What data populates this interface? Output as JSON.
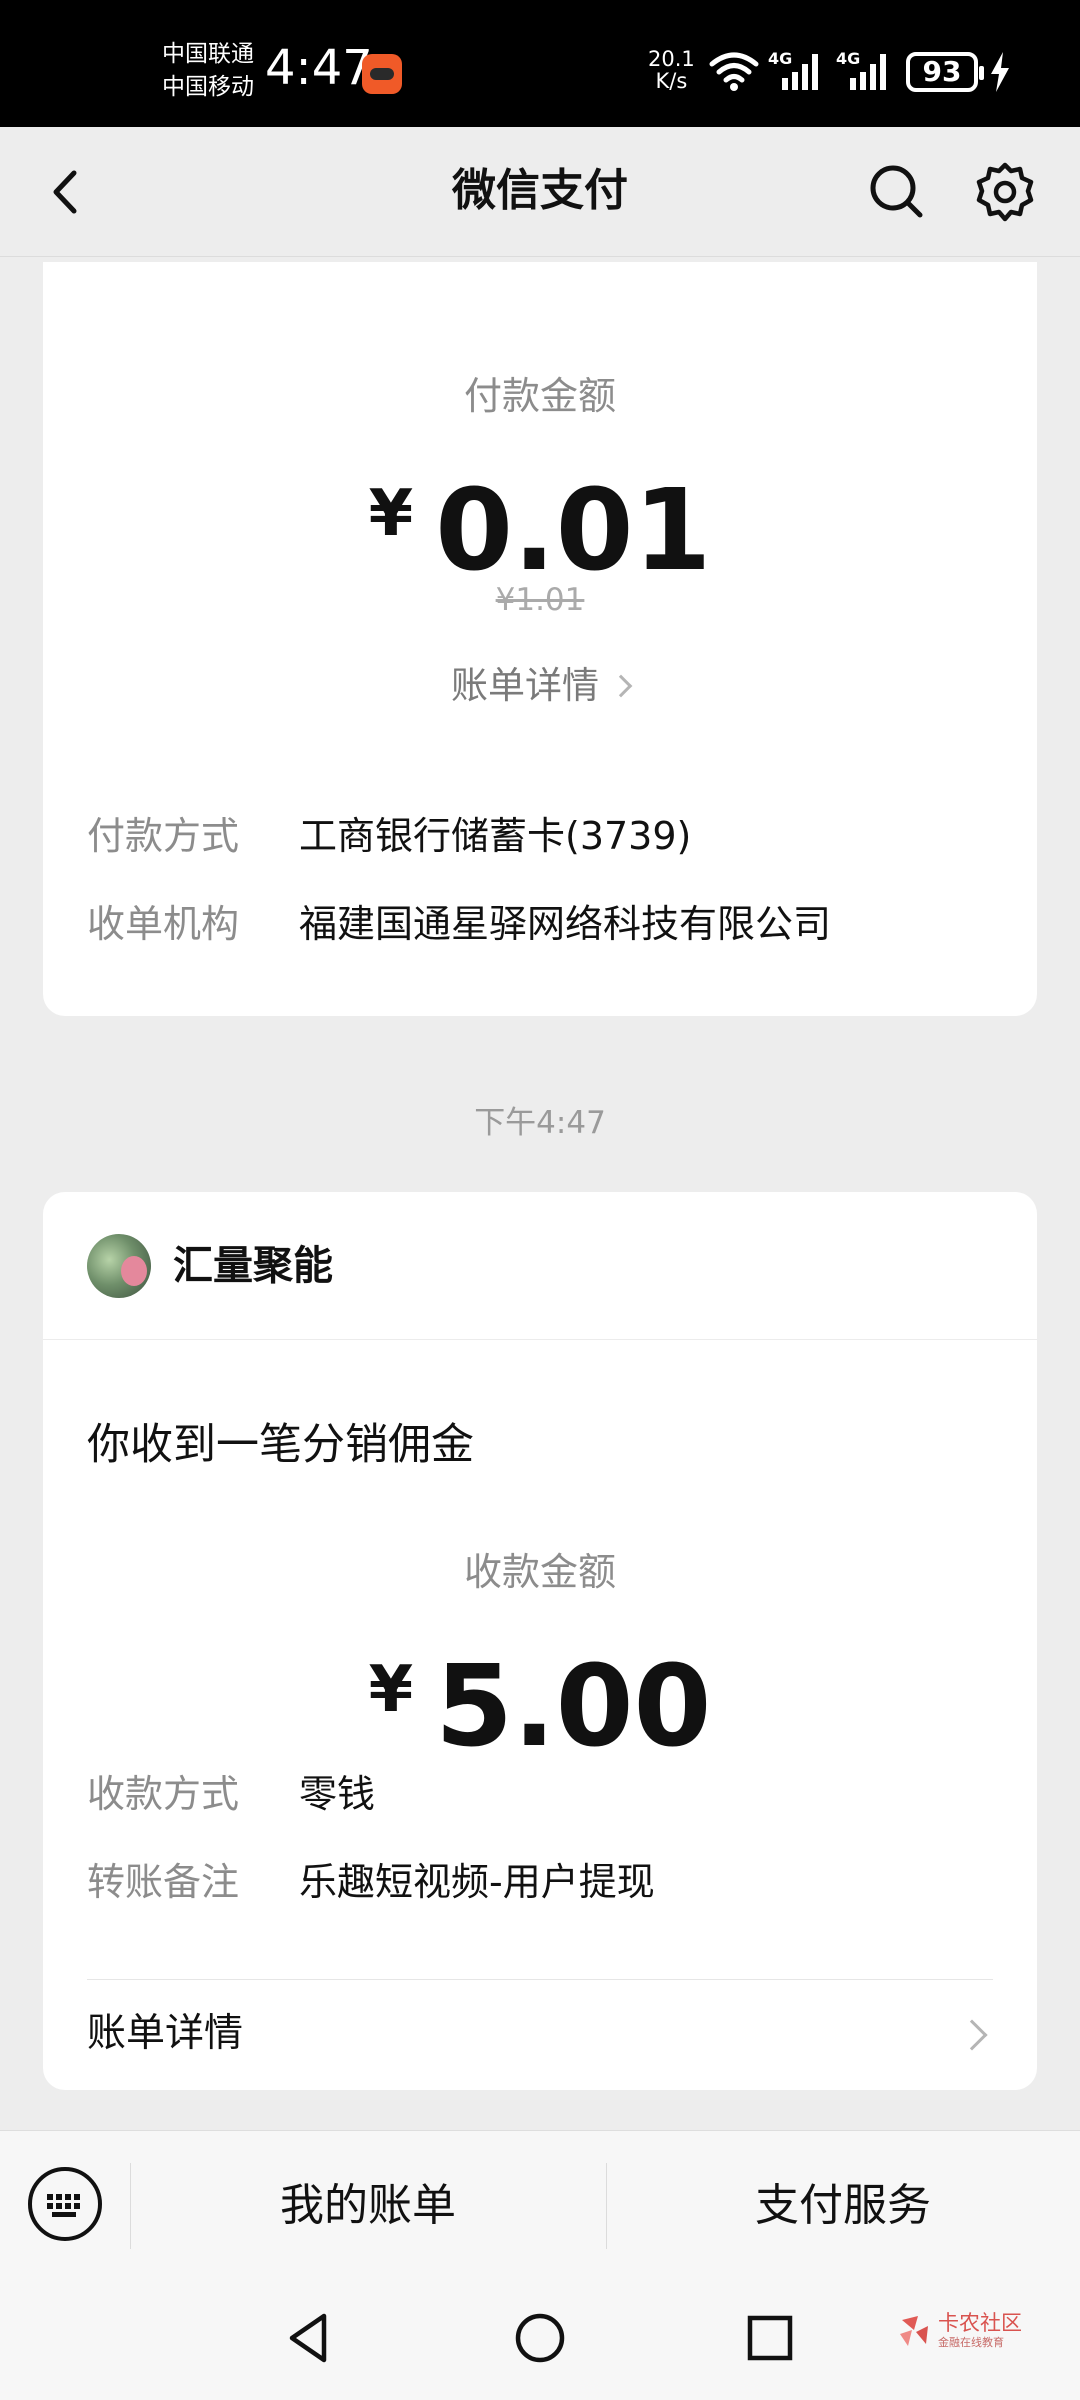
{
  "status_bar": {
    "carrier1": "中国联通",
    "carrier2": "中国移动",
    "time": "4:47",
    "speed_value": "20.1",
    "speed_unit": "K/s",
    "battery": "93",
    "signal1_label": "4G",
    "signal2_label": "4G",
    "wifi_icon": "wifi-icon",
    "charging_icon": "bolt-icon"
  },
  "nav": {
    "title": "微信支付",
    "back_icon": "chevron-left-icon",
    "search_icon": "search-icon",
    "settings_icon": "gear-icon"
  },
  "card1": {
    "amount_label": "付款金额",
    "currency": "¥",
    "amount": "0.01",
    "original_price": "¥1.01",
    "bill_link": "账单详情",
    "rows": [
      {
        "key": "付款方式",
        "value": "工商银行储蓄卡(3739)"
      },
      {
        "key": "收单机构",
        "value": "福建国通星驿网络科技有限公司"
      }
    ]
  },
  "timestamp": "下午4:47",
  "card2": {
    "merchant": "汇量聚能",
    "message": "你收到一笔分销佣金",
    "amount_label": "收款金额",
    "currency": "¥",
    "amount": "5.00",
    "rows": [
      {
        "key": "收款方式",
        "value": "零钱"
      },
      {
        "key": "转账备注",
        "value": "乐趣短视频-用户提现"
      }
    ],
    "detail_label": "账单详情"
  },
  "bottom_tabs": {
    "keyboard_icon": "keyboard-icon",
    "tab1": "我的账单",
    "tab2": "支付服务"
  },
  "watermark": {
    "name": "卡农社区",
    "tagline": "金融在线教育"
  },
  "colors": {
    "background": "#ededed",
    "card": "#ffffff",
    "label_gray": "#8c8c8c",
    "watermark_red": "#d9534f"
  }
}
